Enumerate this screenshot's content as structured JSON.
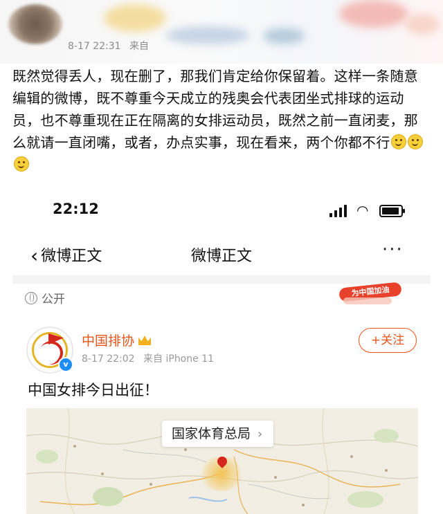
{
  "header": {
    "timestamp": "8-17 22:31",
    "source_prefix": "来自"
  },
  "post": {
    "paragraph": "既然觉得丢人，现在删了，那我们肯定给你保留着。这样一条随意编辑的微博，既不尊重今天成立的残奥会代表团坐式排球的运动员，也不尊重现在正在隔离的女排运动员，既然之前一直闭麦，那么就请一直闭嘴，或者，办点实事，现在看来，两个你都不行",
    "emoji_count": 3,
    "emoji_icon": "slightly-smiling-face"
  },
  "screenshot": {
    "status_bar": {
      "time": "22:12"
    },
    "nav": {
      "back_label": "微博正文",
      "title": "微博正文",
      "more_label": "···"
    },
    "visibility": {
      "label": "公开"
    },
    "badge": {
      "label": "为中国加油"
    },
    "author": {
      "name": "中国排协",
      "timestamp": "8-17 22:02",
      "source": "来自 iPhone 11",
      "follow_label": "+关注",
      "verified_color": "#1e8ef5",
      "name_color": "#e8541a"
    },
    "body": "中国女排今日出征！",
    "map": {
      "location_label": "国家体育总局"
    }
  }
}
